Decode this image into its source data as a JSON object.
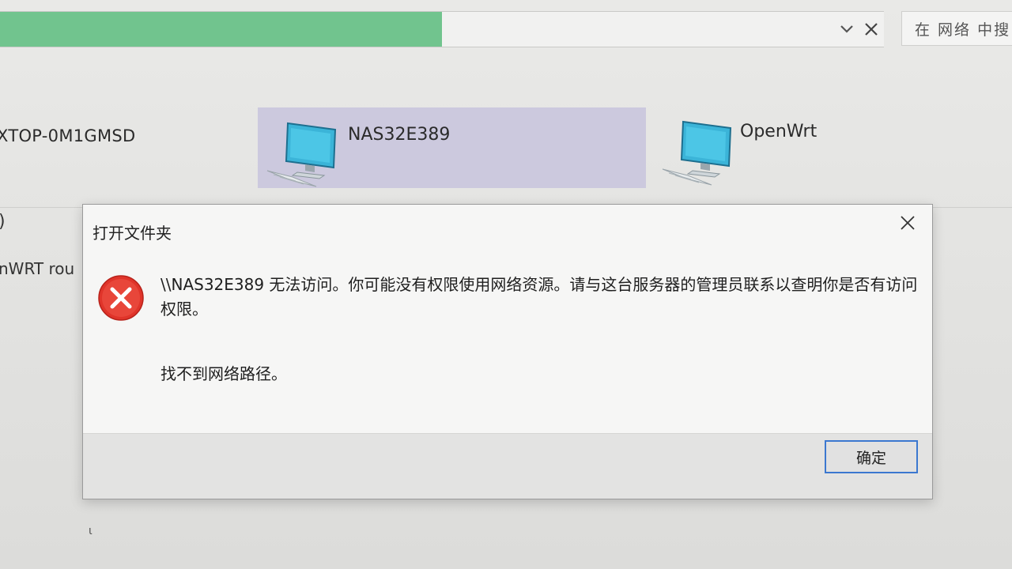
{
  "address_bar": {
    "progress_fraction": 0.5,
    "progress_color": "#71c48e",
    "dropdown_icon": "chevron-down-icon",
    "close_icon": "close-icon"
  },
  "search": {
    "placeholder": "在 网络 中搜"
  },
  "network": {
    "items": [
      {
        "label": "XTOP-0M1GMSD"
      },
      {
        "label": "NAS32E389",
        "selected": true,
        "icon": "computer-icon"
      },
      {
        "label": "OpenWrt",
        "icon": "computer-icon"
      }
    ],
    "left_paren": ")",
    "left_description": "nWRT rou"
  },
  "dialog": {
    "title": "打开文件夹",
    "icon": "error-icon",
    "message": "\\\\NAS32E389 无法访问。你可能没有权限使用网络资源。请与这台服务器的管理员联系以查明你是否有访问权限。",
    "detail": "找不到网络路径。",
    "ok_label": "确定",
    "accent_color": "#3b78d0",
    "error_color": "#e0342a"
  }
}
